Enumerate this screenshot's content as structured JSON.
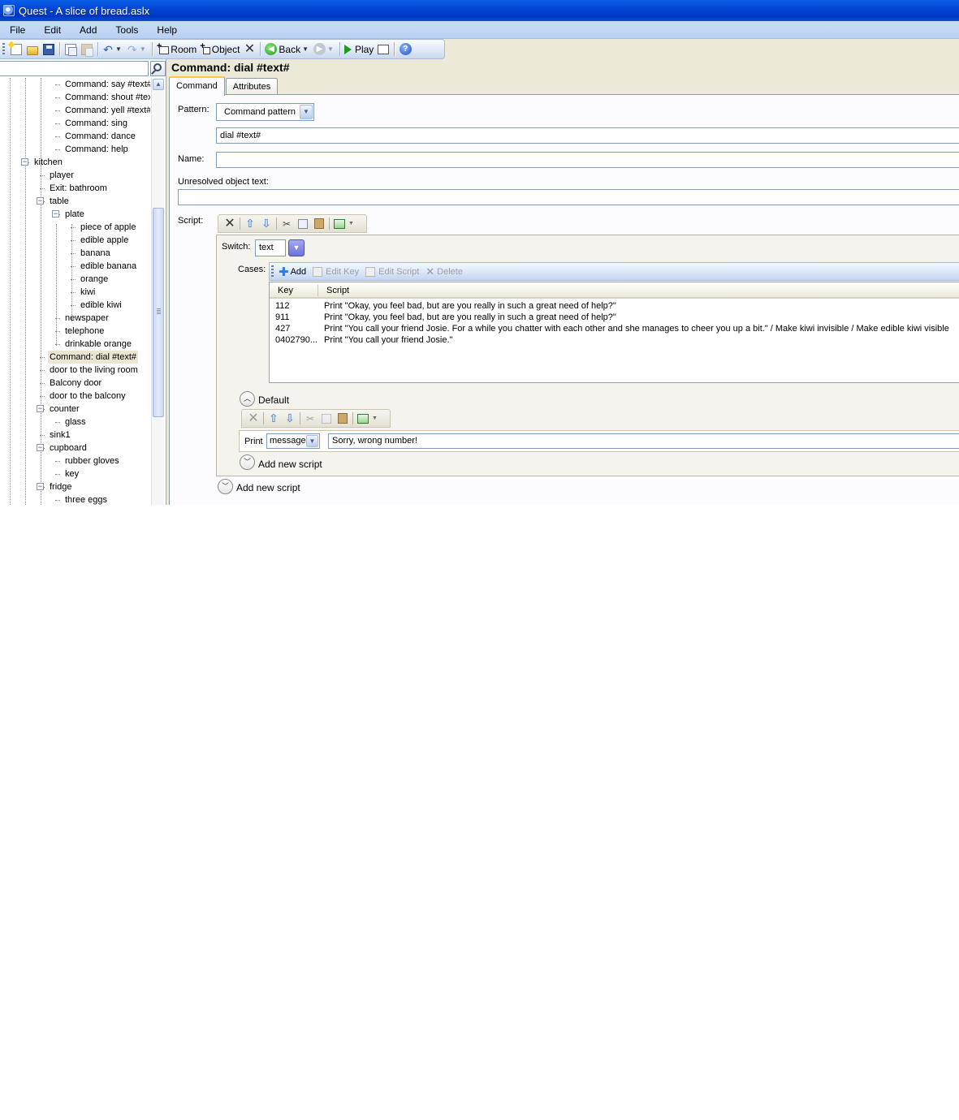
{
  "window": {
    "title": "Quest - A slice of bread.aslx"
  },
  "menu": [
    "File",
    "Edit",
    "Add",
    "Tools",
    "Help"
  ],
  "toolbar": {
    "room_label": "Room",
    "object_label": "Object",
    "back_label": "Back",
    "play_label": "Play"
  },
  "tree": {
    "items": [
      {
        "label": "Command: say #text#",
        "depth": 3
      },
      {
        "label": "Command: shout #text#",
        "depth": 3
      },
      {
        "label": "Command: yell #text#",
        "depth": 3
      },
      {
        "label": "Command: sing",
        "depth": 3
      },
      {
        "label": "Command: dance",
        "depth": 3
      },
      {
        "label": "Command: help",
        "depth": 3
      },
      {
        "label": "kitchen",
        "depth": 1,
        "expander": "minus"
      },
      {
        "label": "player",
        "depth": 2
      },
      {
        "label": "Exit: bathroom",
        "depth": 2
      },
      {
        "label": "table",
        "depth": 2,
        "expander": "minus"
      },
      {
        "label": "plate",
        "depth": 3,
        "expander": "minus"
      },
      {
        "label": "piece of apple",
        "depth": 4
      },
      {
        "label": "edible apple",
        "depth": 4
      },
      {
        "label": "banana",
        "depth": 4
      },
      {
        "label": "edible banana",
        "depth": 4
      },
      {
        "label": "orange",
        "depth": 4
      },
      {
        "label": "kiwi",
        "depth": 4
      },
      {
        "label": "edible kiwi",
        "depth": 4
      },
      {
        "label": "newspaper",
        "depth": 3
      },
      {
        "label": "telephone",
        "depth": 3
      },
      {
        "label": "drinkable orange",
        "depth": 3
      },
      {
        "label": "Command: dial #text#",
        "depth": 2,
        "selected": true
      },
      {
        "label": "door to the living room",
        "depth": 2
      },
      {
        "label": "Balcony door",
        "depth": 2
      },
      {
        "label": "door to the balcony",
        "depth": 2
      },
      {
        "label": "counter",
        "depth": 2,
        "expander": "minus"
      },
      {
        "label": "glass",
        "depth": 3
      },
      {
        "label": "sink1",
        "depth": 2
      },
      {
        "label": "cupboard",
        "depth": 2,
        "expander": "minus"
      },
      {
        "label": "rubber gloves",
        "depth": 3
      },
      {
        "label": "key",
        "depth": 3
      },
      {
        "label": "fridge",
        "depth": 2,
        "expander": "minus"
      },
      {
        "label": "three eggs",
        "depth": 3
      }
    ]
  },
  "editor": {
    "title": "Command: dial #text#",
    "tabs": [
      "Command",
      "Attributes"
    ],
    "pattern_label": "Pattern:",
    "pattern_type": "Command pattern",
    "pattern_value": "dial #text#",
    "name_label": "Name:",
    "name_value": "",
    "unresolved_label": "Unresolved object text:",
    "unresolved_value": "",
    "script_label": "Script:",
    "switch_label": "Switch:",
    "switch_value": "text",
    "cases_label": "Cases:",
    "cases_toolbar": {
      "add": "Add",
      "edit_key": "Edit Key",
      "edit_script": "Edit Script",
      "delete": "Delete"
    },
    "cases_columns": {
      "key": "Key",
      "script": "Script"
    },
    "cases": [
      {
        "key": "112",
        "script": "Print \"Okay, you feel bad, but are you really in such a great need of help?\""
      },
      {
        "key": "911",
        "script": "Print \"Okay, you feel bad, but are you really in such a great need of help?\""
      },
      {
        "key": "427",
        "script": "Print \"You call your friend Josie. For a while you chatter with each other and she manages to cheer you up a bit.\" / Make kiwi invisible / Make edible kiwi visible"
      },
      {
        "key": "0402790...",
        "script": "Print \"You call your friend Josie.\""
      }
    ],
    "default_label": "Default",
    "print_label": "Print",
    "print_type": "message",
    "print_value": "Sorry, wrong number!",
    "add_new_script_inner": "Add new script",
    "add_new_script_outer": "Add new script"
  }
}
